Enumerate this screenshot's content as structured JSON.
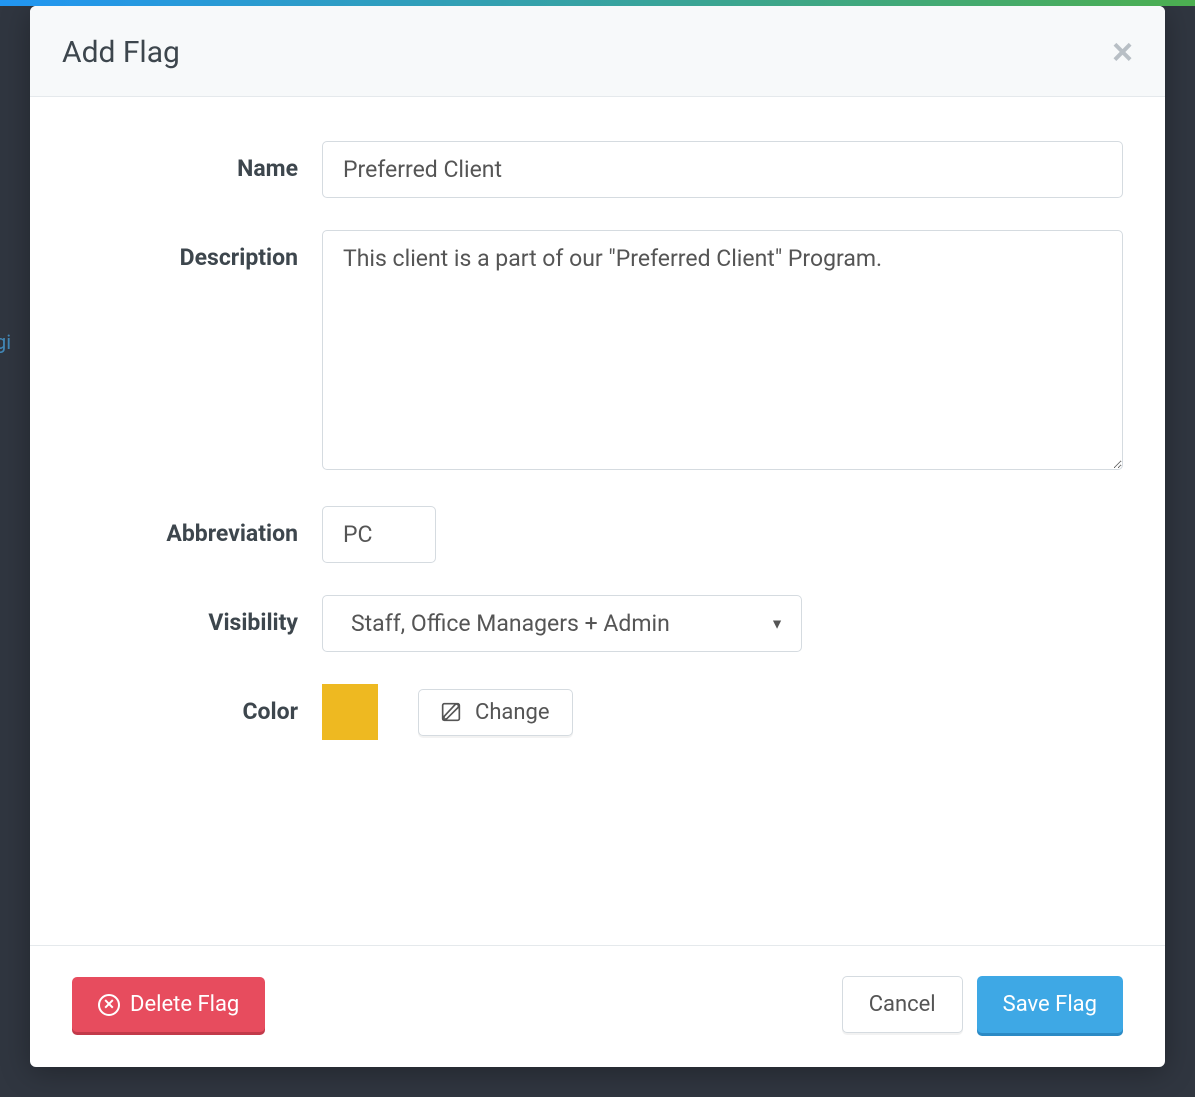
{
  "modal": {
    "title": "Add Flag",
    "close_label": "×"
  },
  "form": {
    "name": {
      "label": "Name",
      "value": "Preferred Client"
    },
    "description": {
      "label": "Description",
      "value": "This client is a part of our \"Preferred Client\" Program."
    },
    "abbreviation": {
      "label": "Abbreviation",
      "value": "PC"
    },
    "visibility": {
      "label": "Visibility",
      "value": "Staff, Office Managers + Admin"
    },
    "color": {
      "label": "Color",
      "swatch_hex": "#eeb921",
      "change_label": "Change"
    }
  },
  "footer": {
    "delete_label": "Delete Flag",
    "cancel_label": "Cancel",
    "save_label": "Save Flag"
  }
}
